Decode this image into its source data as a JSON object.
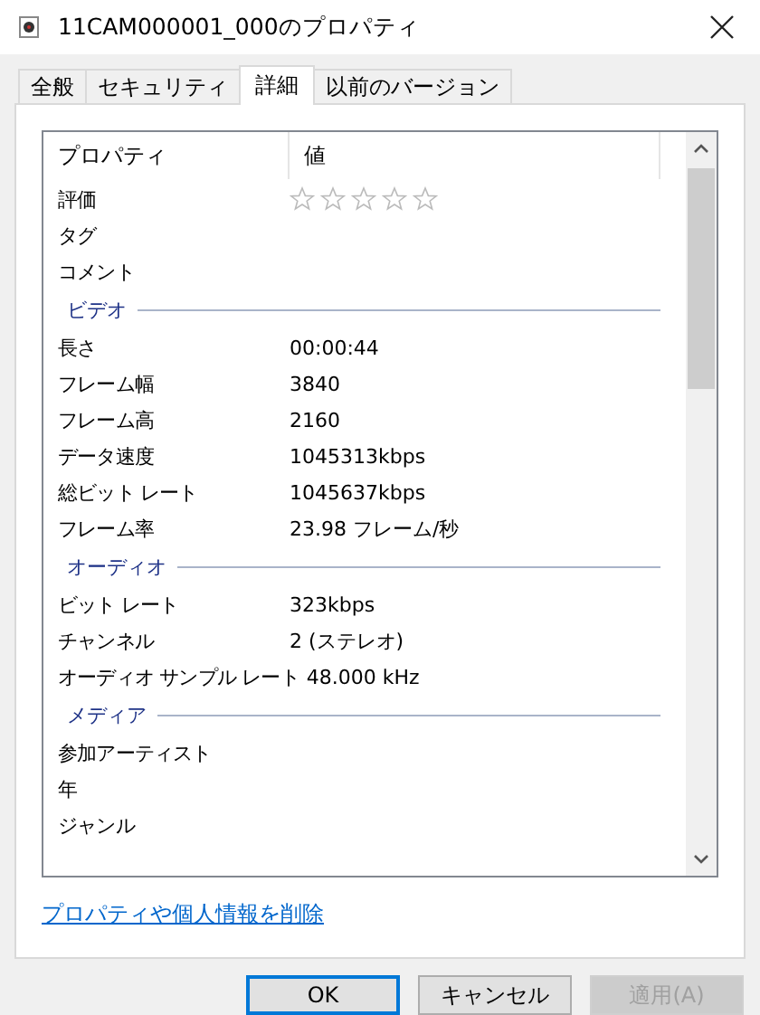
{
  "window": {
    "title": "11CAM000001_000のプロパティ"
  },
  "tabs": [
    {
      "label": "全般",
      "selected": false
    },
    {
      "label": "セキュリティ",
      "selected": false
    },
    {
      "label": "詳細",
      "selected": true
    },
    {
      "label": "以前のバージョン",
      "selected": false
    }
  ],
  "table": {
    "columns": [
      "プロパティ",
      "値"
    ],
    "rows": [
      {
        "kind": "rating",
        "name": "評価",
        "stars": 0
      },
      {
        "kind": "property",
        "name": "タグ"
      },
      {
        "kind": "property",
        "name": "コメント"
      },
      {
        "kind": "group",
        "name": "ビデオ"
      },
      {
        "kind": "property",
        "name": "長さ",
        "value": "00:00:44"
      },
      {
        "kind": "property",
        "name": "フレーム幅",
        "value": "3840"
      },
      {
        "kind": "property",
        "name": "フレーム高",
        "value": "2160"
      },
      {
        "kind": "property",
        "name": "データ速度",
        "value": "1045313kbps"
      },
      {
        "kind": "property",
        "name": "総ビット レート",
        "value": "1045637kbps"
      },
      {
        "kind": "property",
        "name": "フレーム率",
        "value": "23.98 フレーム/秒"
      },
      {
        "kind": "group",
        "name": "オーディオ"
      },
      {
        "kind": "property",
        "name": "ビット レート",
        "value": "323kbps"
      },
      {
        "kind": "property",
        "name": "チャンネル",
        "value": "2 (ステレオ)"
      },
      {
        "kind": "property",
        "name": "オーディオ サンプル レート",
        "value": "48.000 kHz"
      },
      {
        "kind": "group",
        "name": "メディア"
      },
      {
        "kind": "property",
        "name": "参加アーティスト"
      },
      {
        "kind": "property",
        "name": "年"
      },
      {
        "kind": "property",
        "name": "ジャンル"
      }
    ]
  },
  "link": "プロパティや個人情報を削除",
  "buttons": [
    {
      "label": "OK",
      "kind": "default",
      "disabled": false
    },
    {
      "label": "キャンセル",
      "kind": "normal",
      "disabled": false
    },
    {
      "label": "適用(A)",
      "kind": "normal",
      "disabled": true
    }
  ]
}
